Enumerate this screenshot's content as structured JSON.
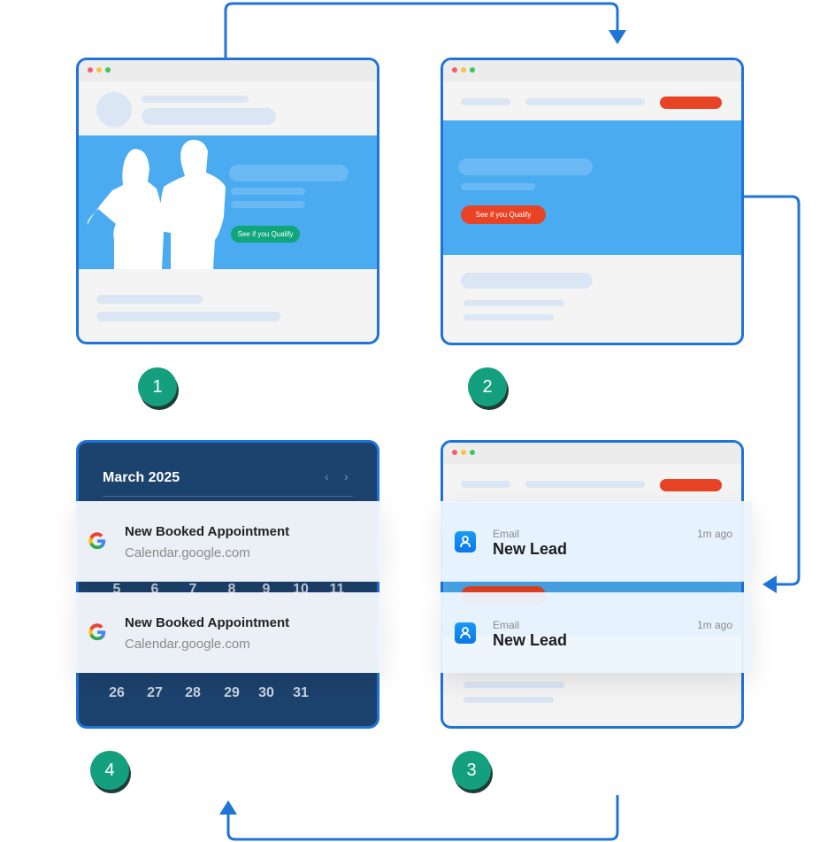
{
  "steps": [
    "1",
    "2",
    "3",
    "4"
  ],
  "colors": {
    "accent": "#1f74d8",
    "hero": "#4aabf0",
    "green": "#14a07e",
    "red": "#e84325",
    "calendar": "#1c426e"
  },
  "panel1": {
    "cta": "See if you Qualify"
  },
  "panel2": {
    "cta": "See if you Qualify"
  },
  "panel3": {
    "notifications": [
      {
        "source": "Email",
        "title": "New Lead",
        "time": "1m ago",
        "icon": "user-icon"
      },
      {
        "source": "Email",
        "title": "New Lead",
        "time": "1m ago",
        "icon": "user-icon"
      }
    ]
  },
  "panel4": {
    "month": "March 2025",
    "week_row": [
      "5",
      "6",
      "7",
      "8",
      "9",
      "10",
      "11"
    ],
    "last_row": [
      "26",
      "27",
      "28",
      "29",
      "30",
      "31"
    ],
    "notifications": [
      {
        "title": "New Booked Appointment",
        "subtitle": "Calendar.google.com",
        "icon": "google-icon"
      },
      {
        "title": "New Booked Appointment",
        "subtitle": "Calendar.google.com",
        "icon": "google-icon"
      }
    ]
  }
}
